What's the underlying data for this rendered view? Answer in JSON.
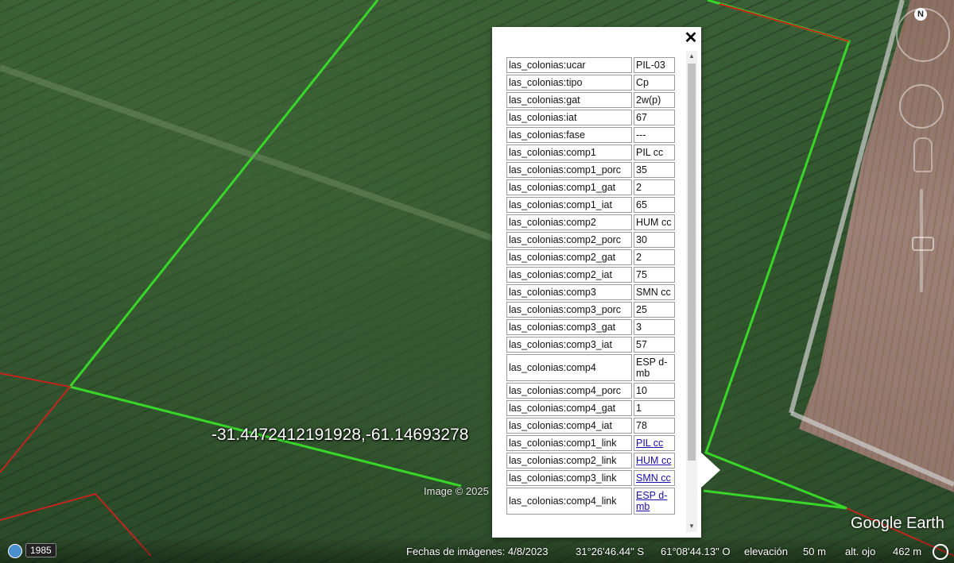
{
  "map": {
    "coordinate_label": "-31.4472412191928,-61.14693278",
    "image_credit": "Image © 2025",
    "logo": "Google Earth",
    "north_label": "N"
  },
  "popup": {
    "close_label": "✕",
    "rows": [
      {
        "key": "las_colonias:ucar",
        "value": "PIL-03",
        "link": false
      },
      {
        "key": "las_colonias:tipo",
        "value": "Cp",
        "link": false
      },
      {
        "key": "las_colonias:gat",
        "value": "2w(p)",
        "link": false
      },
      {
        "key": "las_colonias:iat",
        "value": "67",
        "link": false
      },
      {
        "key": "las_colonias:fase",
        "value": "---",
        "link": false
      },
      {
        "key": "las_colonias:comp1",
        "value": "PIL cc",
        "link": false
      },
      {
        "key": "las_colonias:comp1_porc",
        "value": "35",
        "link": false
      },
      {
        "key": "las_colonias:comp1_gat",
        "value": "2",
        "link": false
      },
      {
        "key": "las_colonias:comp1_iat",
        "value": "65",
        "link": false
      },
      {
        "key": "las_colonias:comp2",
        "value": "HUM cc",
        "link": false
      },
      {
        "key": "las_colonias:comp2_porc",
        "value": "30",
        "link": false
      },
      {
        "key": "las_colonias:comp2_gat",
        "value": "2",
        "link": false
      },
      {
        "key": "las_colonias:comp2_iat",
        "value": "75",
        "link": false
      },
      {
        "key": "las_colonias:comp3",
        "value": "SMN cc",
        "link": false
      },
      {
        "key": "las_colonias:comp3_porc",
        "value": "25",
        "link": false
      },
      {
        "key": "las_colonias:comp3_gat",
        "value": "3",
        "link": false
      },
      {
        "key": "las_colonias:comp3_iat",
        "value": "57",
        "link": false
      },
      {
        "key": "las_colonias:comp4",
        "value": "ESP d-mb",
        "link": false
      },
      {
        "key": "las_colonias:comp4_porc",
        "value": "10",
        "link": false
      },
      {
        "key": "las_colonias:comp4_gat",
        "value": "1",
        "link": false
      },
      {
        "key": "las_colonias:comp4_iat",
        "value": "78",
        "link": false
      },
      {
        "key": "las_colonias:comp1_link",
        "value": "PIL cc",
        "link": true
      },
      {
        "key": "las_colonias:comp2_link",
        "value": "HUM cc",
        "link": true
      },
      {
        "key": "las_colonias:comp3_link",
        "value": "SMN cc",
        "link": true
      },
      {
        "key": "las_colonias:comp4_link",
        "value": "ESP d-mb",
        "link": true
      }
    ]
  },
  "statusbar": {
    "year": "1985",
    "imagery_date": "Fechas de imágenes: 4/8/2023",
    "latitude": "31°26'46.44\" S",
    "longitude": "61°08'44.13\" O",
    "elevation_label": "elevación",
    "elevation_value": "50 m",
    "eye_alt_label": "alt. ojo",
    "eye_alt_value": "462 m"
  },
  "colors": {
    "boundary_green": "#39d62a",
    "boundary_red": "#c0261e"
  }
}
